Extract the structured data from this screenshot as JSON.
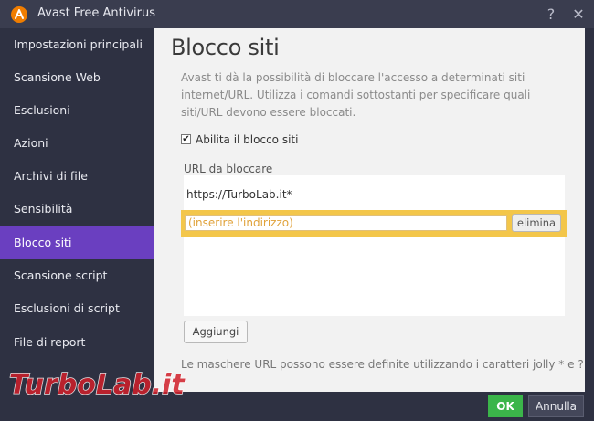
{
  "window": {
    "title": "Avast Free Antivirus",
    "help_glyph": "?",
    "close_glyph": "✕",
    "logo_icon": "avast-logo-icon"
  },
  "sidebar": {
    "items": [
      {
        "label": "Impostazioni principali",
        "active": false
      },
      {
        "label": "Scansione Web",
        "active": false
      },
      {
        "label": "Esclusioni",
        "active": false
      },
      {
        "label": "Azioni",
        "active": false
      },
      {
        "label": "Archivi di file",
        "active": false
      },
      {
        "label": "Sensibilità",
        "active": false
      },
      {
        "label": "Blocco siti",
        "active": true
      },
      {
        "label": "Scansione script",
        "active": false
      },
      {
        "label": "Esclusioni di script",
        "active": false
      },
      {
        "label": "File di report",
        "active": false
      }
    ]
  },
  "main": {
    "title": "Blocco siti",
    "description": "Avast ti dà la possibilità di bloccare l'accesso a determinati siti internet/URL. Utilizza i comandi sottostanti per specificare quali siti/URL devono essere bloccati.",
    "enable_checkbox": {
      "label": "Abilita il blocco siti",
      "checked": true,
      "glyph": "✔"
    },
    "url_list_label": "URL da bloccare",
    "urls": [
      "https://TurboLab.it*"
    ],
    "new_url_input": {
      "value": "",
      "placeholder": "(inserire l'indirizzo)"
    },
    "delete_label": "elimina",
    "add_label": "Aggiungi",
    "footnote": "Le maschere URL possono essere definite utilizzando i caratteri jolly * e ?"
  },
  "footer": {
    "ok_label": "OK",
    "cancel_label": "Annulla"
  },
  "watermark": {
    "text": "TurboLab.it"
  },
  "colors": {
    "sidebar_bg": "#2e3142",
    "active_item": "#6a3fc0",
    "ok_green": "#3bb54a",
    "edit_highlight": "#f3c64a",
    "avast_orange": "#f07d00"
  }
}
